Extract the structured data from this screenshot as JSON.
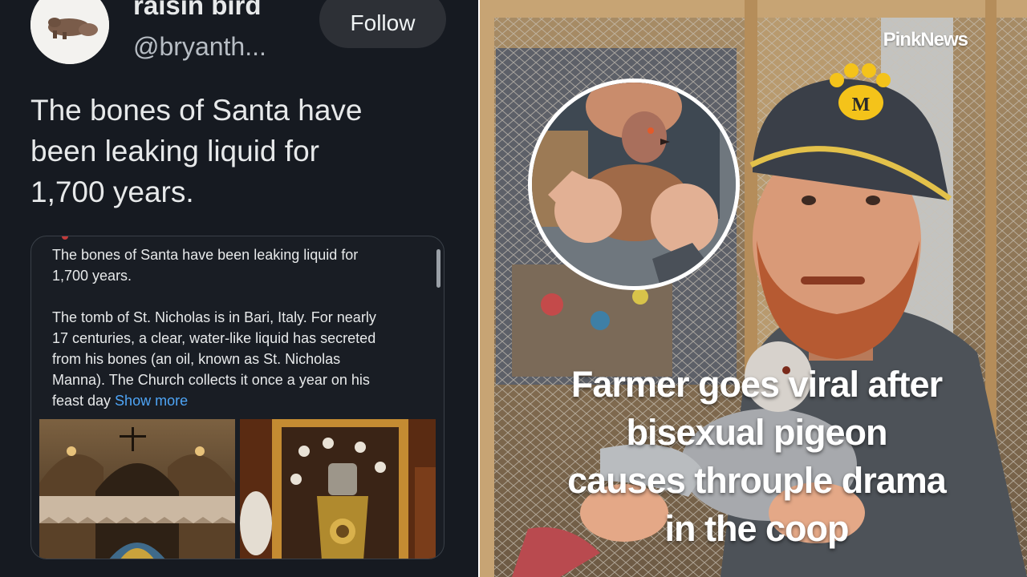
{
  "post": {
    "display_name": "raisin bird",
    "handle": "@bryanth...",
    "follow_label": "Follow",
    "text_lines": [
      "The bones of Santa have",
      "been leaking liquid for",
      "1,700 years."
    ],
    "avatar_icon": "hippo-avatar-icon"
  },
  "card": {
    "para1_lines": [
      "The bones of Santa have been leaking liquid for",
      "1,700 years."
    ],
    "para2_lines": [
      "The tomb of St. Nicholas is in Bari, Italy. For nearly",
      "17 centuries, a clear, water-like liquid has secreted",
      "from his bones (an oil, known as St. Nicholas",
      "Manna). The Church collects it once a year on his",
      "feast day "
    ],
    "show_more": "Show more",
    "link_color": "#4ea4f5"
  },
  "news": {
    "brand": "PinkNews",
    "headline_lines": [
      "Farmer goes viral after",
      "bisexual pigeon",
      "causes throuple drama",
      "in the coop"
    ],
    "cap_letter": "M",
    "cap_logo_color": "#f4c31a"
  },
  "colors": {
    "post_bg": "#161a21",
    "text_primary": "#e7e9ea",
    "follow_bg": "#2d3036"
  }
}
